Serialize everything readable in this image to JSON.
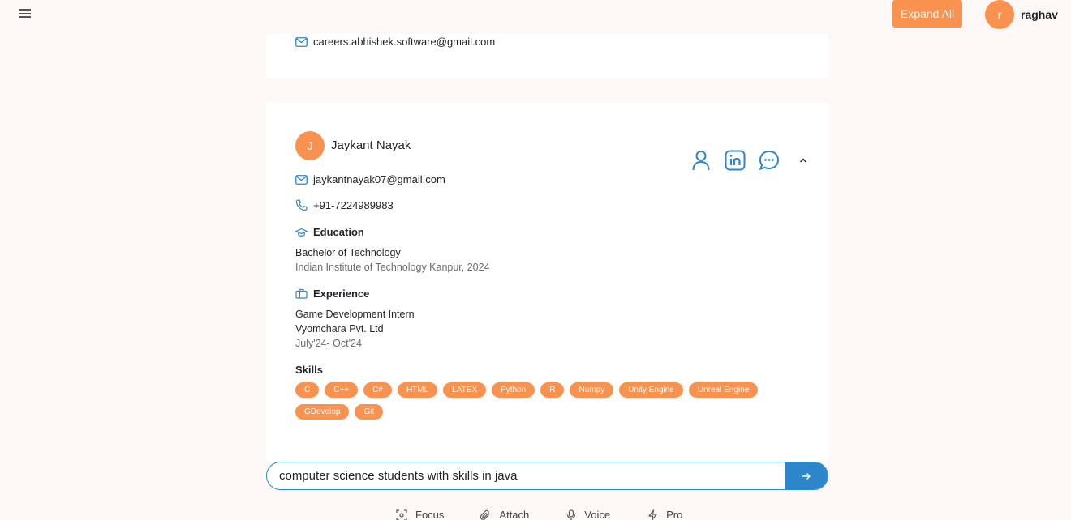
{
  "header": {
    "expand_all_label": "Expand All",
    "user_initial": "r",
    "user_name": "raghav"
  },
  "previous_card": {
    "email": "careers.abhishek.software@gmail.com"
  },
  "candidate": {
    "initial": "J",
    "name": "Jaykant Nayak",
    "email": "jaykantnayak07@gmail.com",
    "phone": "+91-7224989983",
    "education_heading": "Education",
    "degree": "Bachelor of Technology",
    "institution": "Indian Institute of Technology Kanpur, 2024",
    "experience_heading": "Experience",
    "role": "Game Development Intern",
    "company": "Vyomchara Pvt. Ltd",
    "duration": "July'24- Oct'24",
    "skills_heading": "Skills",
    "skills": [
      "C",
      "C++",
      "C#",
      "HTML",
      "LATEX",
      "Python",
      "R",
      "Numpy",
      "Unity Engine",
      "Unreal Engine",
      "GDevelop",
      "Git"
    ],
    "action_icons": [
      "profile-icon",
      "linkedin-icon",
      "chat-icon",
      "chevron-up-icon"
    ]
  },
  "search": {
    "value": "computer science students with skills in java",
    "send_icon": "arrow-right-icon"
  },
  "toolbar": {
    "focus_label": "Focus",
    "attach_label": "Attach",
    "voice_label": "Voice",
    "pro_label": "Pro"
  },
  "colors": {
    "accent_orange": "#f9914f",
    "accent_blue": "#2c86c9",
    "background": "#fdf8f5"
  }
}
